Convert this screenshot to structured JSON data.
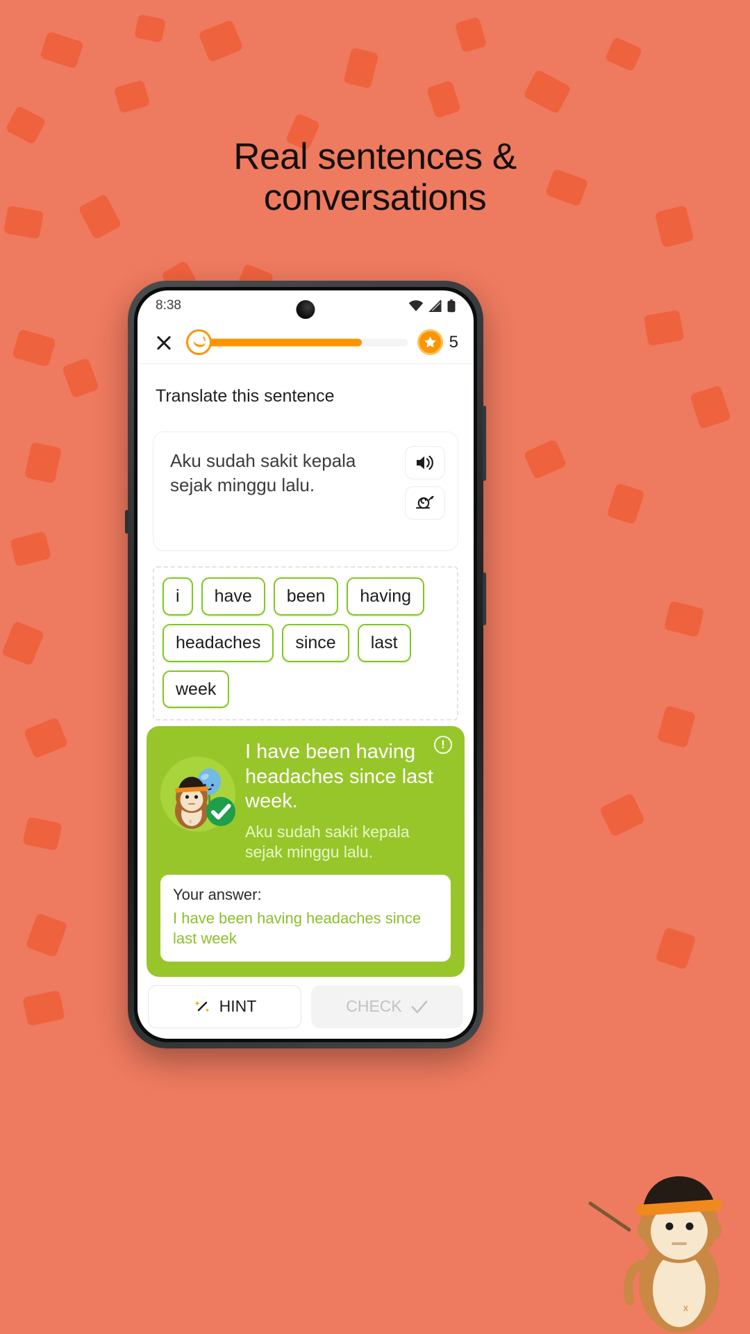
{
  "promo": {
    "headline_line1": "Real sentences &",
    "headline_line2": "conversations",
    "bg_color": "#ee7a5f",
    "confetti_color": "#ef5f3c"
  },
  "phone": {
    "statusbar": {
      "time": "8:38",
      "icons": [
        "wifi-icon",
        "signal-icon",
        "battery-icon"
      ]
    },
    "header": {
      "close_icon": "close-icon",
      "progress_icon": "banana-icon",
      "progress_percent": 78,
      "coin_icon": "star-coin-icon",
      "coin_count": "5",
      "accent_color": "#fb9500"
    },
    "exercise": {
      "prompt": "Translate this sentence",
      "sentence": "Aku sudah sakit kepala sejak minggu lalu.",
      "audio_button": "speaker-icon",
      "slow_audio_button": "snail-icon",
      "word_tiles": [
        "i",
        "have",
        "been",
        "having",
        "headaches",
        "since",
        "last",
        "week"
      ],
      "tile_border_color": "#7ec81e"
    },
    "feedback": {
      "info_icon": "info-icon",
      "mascot_icon": "monkey-mascot-icon",
      "check_icon": "check-circle-icon",
      "correct_answer": "I have been having headaches since last week.",
      "source_sentence": "Aku sudah sakit kepala sejak minggu lalu.",
      "your_answer_label": "Your answer:",
      "your_answer_value": "I have been having headaches since last week",
      "panel_color": "#97c62b",
      "answer_text_color": "#8cbf2a"
    },
    "bottom": {
      "hint_label": "HINT",
      "hint_icon": "magic-wand-icon",
      "check_label": "CHECK",
      "check_icon": "check-icon"
    }
  }
}
